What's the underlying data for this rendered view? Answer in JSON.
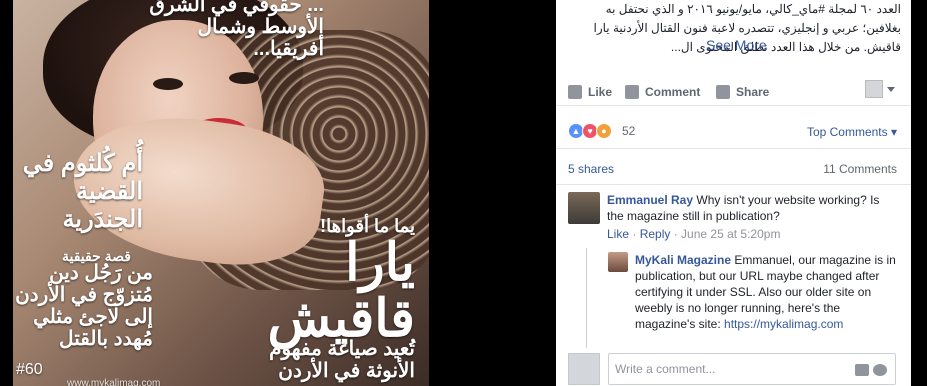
{
  "cover": {
    "top_lines": "... حقوقي في الشرق الأوسط وشمال أفريقيا...",
    "headline": "أُم كُلثوم في القضية الجندَرية",
    "story_label": "قصة حقيقية",
    "story": "من رَجُل دين مُتزوّج في الأردن إلى لاجئ مثلي مُهدد بالقتل",
    "tag": "يما ما أقواها!",
    "name": "يارا قاقيش",
    "subtitle": "تُعيد صياغة مفهوم الأنوثة في الأردن",
    "issue": "#60",
    "site": "www.mykalimag.com"
  },
  "post": {
    "caption": "العدد ٦٠ لمجلة #ماي_كالي، مايو/يونيو ٢٠١٦ و الذي نحتفل به بغلافين؛ عربي و إنجليزي، تتصدره لاعبة فنون القتال الأردنية يارا قاقيش. من خلال هذا العدد نطلق المحتوى ال...",
    "see_more": "See More",
    "actions": {
      "like": "Like",
      "comment": "Comment",
      "share": "Share"
    },
    "reaction_count": "52",
    "top_comments": "Top Comments",
    "shares": "5 shares",
    "comments_count": "11 Comments"
  },
  "comments": [
    {
      "author": "Emmanuel Ray",
      "text": "Why isn't your website working? Is the magazine still in publication?",
      "like": "Like",
      "reply": "Reply",
      "time": "June 25 at 5:20pm"
    },
    {
      "author": "MyKali Magazine",
      "text": "Emmanuel, our magazine is in publication, but our URL maybe changed after certifying it under SSL. Also our older site on weebly is no longer running, here's the magazine's site:",
      "url": "https://mykalimag.com"
    }
  ],
  "composer": {
    "placeholder": "Write a comment..."
  },
  "colors": {
    "link": "#365899",
    "meta": "#90949c",
    "like_reaction": "#5890ff",
    "love_reaction": "#f25268"
  }
}
